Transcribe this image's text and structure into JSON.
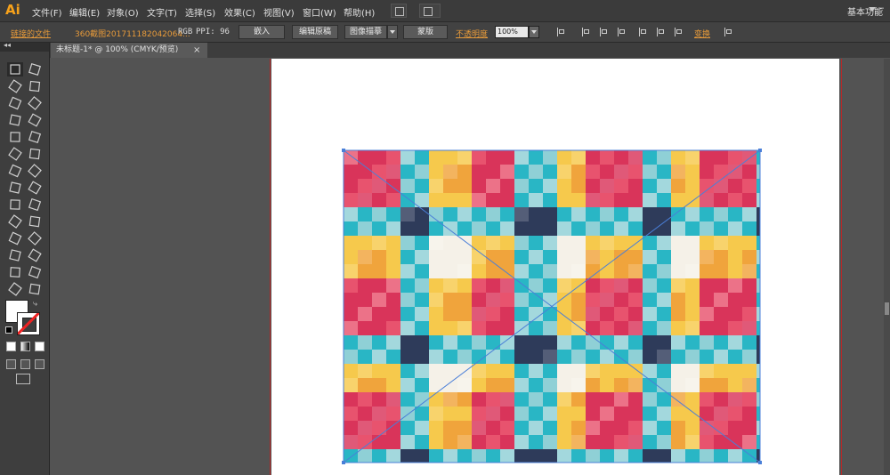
{
  "app": {
    "logo": "Ai"
  },
  "menu": [
    "文件(F)",
    "编辑(E)",
    "对象(O)",
    "文字(T)",
    "选择(S)",
    "效果(C)",
    "视图(V)",
    "窗口(W)",
    "帮助(H)"
  ],
  "workspace": {
    "label": "基本功能"
  },
  "control_bar": {
    "linked_file": "链接的文件",
    "file_name": "360截图2017111820420​64...",
    "color_mode": "RGB",
    "ppi": "PPI: 96",
    "embed": "嵌入",
    "edit_original": "编辑原稿",
    "image_trace": "图像描摹",
    "mask": "蒙版",
    "opacity_label": "不透明度",
    "opacity_value": "100%",
    "transform": "变换"
  },
  "document_tab": {
    "title": "未标题-1* @ 100% (CMYK/预览)",
    "close": "×"
  },
  "toolbox": {
    "collapse": "◂◂",
    "tools": [
      "selection-tool",
      "direct-selection-tool",
      "magic-wand-tool",
      "lasso-tool",
      "pen-tool",
      "type-tool",
      "line-tool",
      "rectangle-tool",
      "paintbrush-tool",
      "pencil-tool",
      "blob-brush-tool",
      "eraser-tool",
      "rotate-tool",
      "scale-tool",
      "width-tool",
      "free-transform-tool",
      "shape-builder-tool",
      "graph-tool",
      "mesh-tool",
      "gradient-tool",
      "eyedropper-tool",
      "blend-tool",
      "symbol-sprayer-tool",
      "column-graph-tool",
      "artboard-tool",
      "slice-tool",
      "hand-tool",
      "zoom-tool"
    ]
  },
  "colors": {
    "accent": "#f7a21b",
    "pattern": [
      "#d9345a",
      "#e8536e",
      "#f0a43c",
      "#f6c94c",
      "#29b6c5",
      "#8fd0d6",
      "#2e3b5a",
      "#4f9b6e",
      "#f5f1e8"
    ]
  }
}
